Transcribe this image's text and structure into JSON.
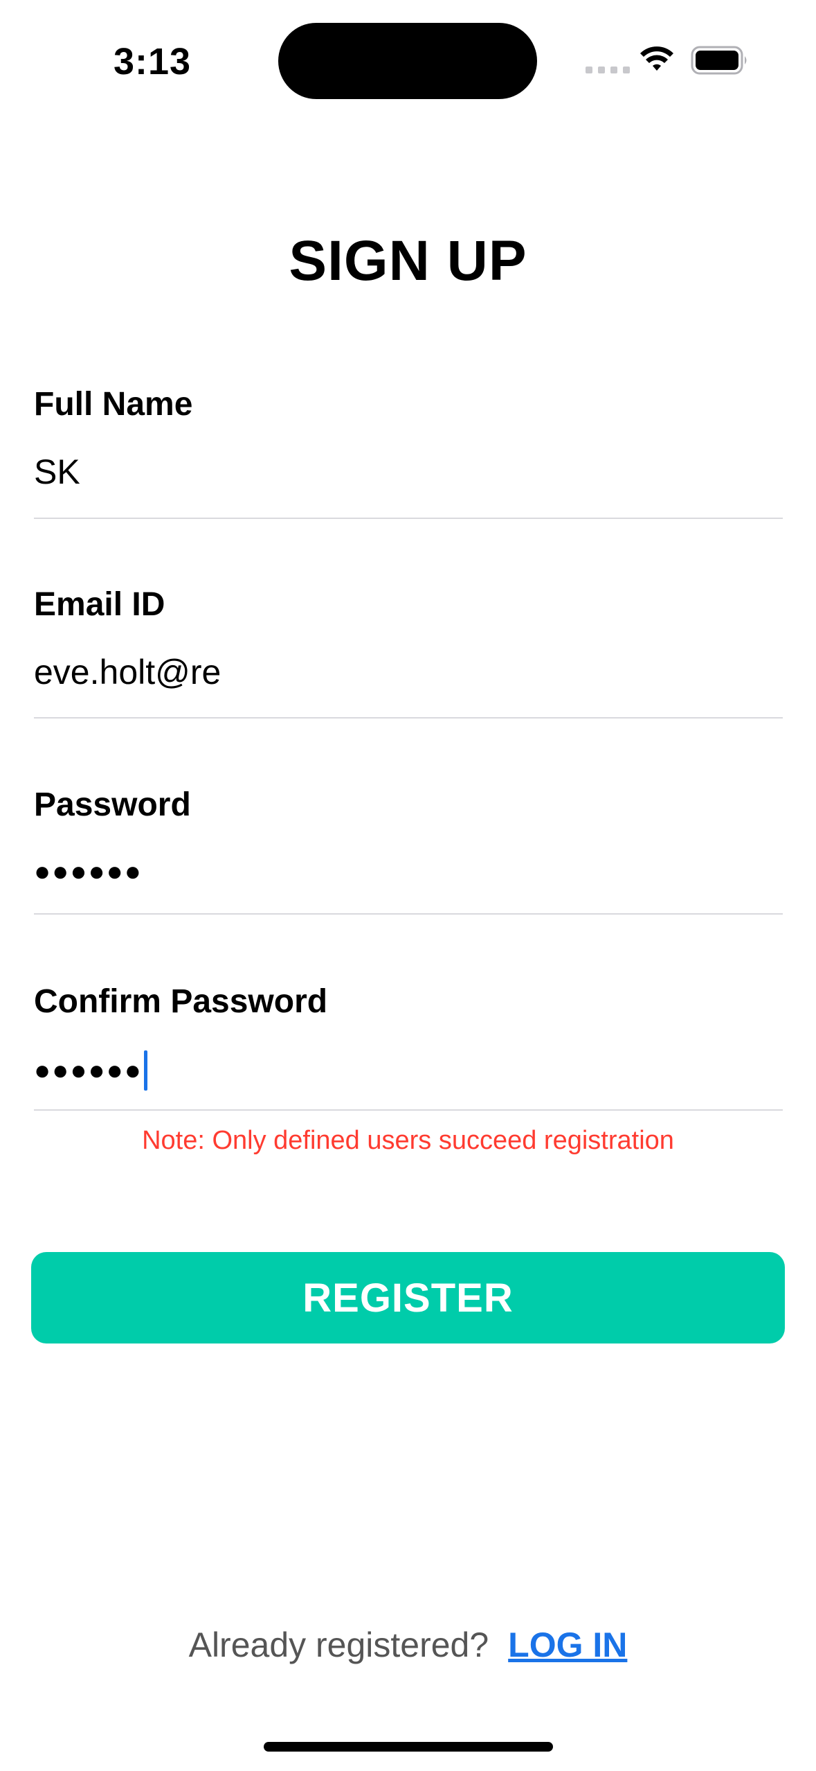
{
  "status_bar": {
    "time": "3:13"
  },
  "page": {
    "title": "SIGN UP"
  },
  "form": {
    "full_name": {
      "label": "Full Name",
      "value": "SK"
    },
    "email": {
      "label": "Email ID",
      "value": "eve.holt@re"
    },
    "password": {
      "label": "Password",
      "masked_value": "●●●●●●"
    },
    "confirm_password": {
      "label": "Confirm Password",
      "masked_value": "●●●●●●"
    },
    "note": "Note: Only defined users succeed registration",
    "register_label": "REGISTER"
  },
  "footer": {
    "prompt": "Already registered?",
    "login_label": "LOG IN"
  },
  "colors": {
    "accent": "#00ccaa",
    "link": "#1a73e8",
    "note": "#ff3b30"
  },
  "icons": {
    "wifi": "wifi-icon",
    "battery": "battery-icon",
    "cellular": "cellular-signal-icon"
  }
}
